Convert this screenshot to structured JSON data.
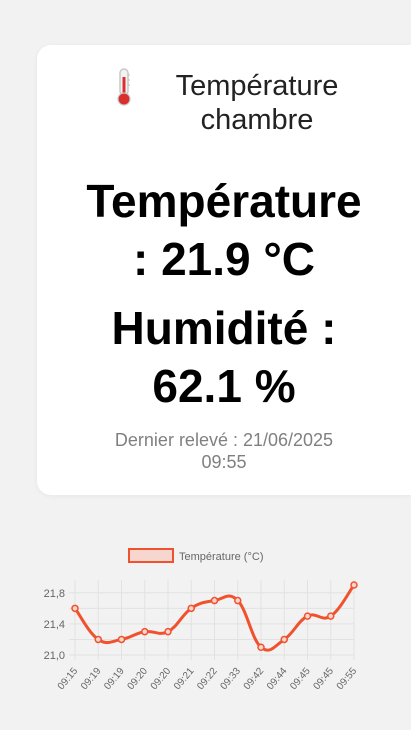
{
  "card": {
    "title": "Température chambre",
    "title_line1": "Température",
    "title_line2": "chambre",
    "temperature_line1": "Température",
    "temperature_line2": ": 21.9 °C",
    "humidity_line1": "Humidité :",
    "humidity_line2": "62.1 %",
    "last_reading_line1": "Dernier relevé : 21/06/2025",
    "last_reading_line2": "09:55",
    "icon": "thermometer-icon"
  },
  "chart_data": {
    "type": "line",
    "title": "",
    "xlabel": "",
    "ylabel": "",
    "legend": "top",
    "grid": true,
    "ylim": [
      21.0,
      21.9
    ],
    "y_ticks": [
      "21,0",
      "21,4",
      "21,8"
    ],
    "categories": [
      "09:15",
      "09:19",
      "09:19",
      "09:20",
      "09:20",
      "09:21",
      "09:22",
      "09:33",
      "09:42",
      "09:44",
      "09:45",
      "09:45",
      "09:55"
    ],
    "series": [
      {
        "name": "Température (°C)",
        "color": "#f0522e",
        "values": [
          21.6,
          21.2,
          21.2,
          21.3,
          21.3,
          21.6,
          21.7,
          21.7,
          21.1,
          21.2,
          21.5,
          21.5,
          21.9
        ]
      }
    ]
  }
}
